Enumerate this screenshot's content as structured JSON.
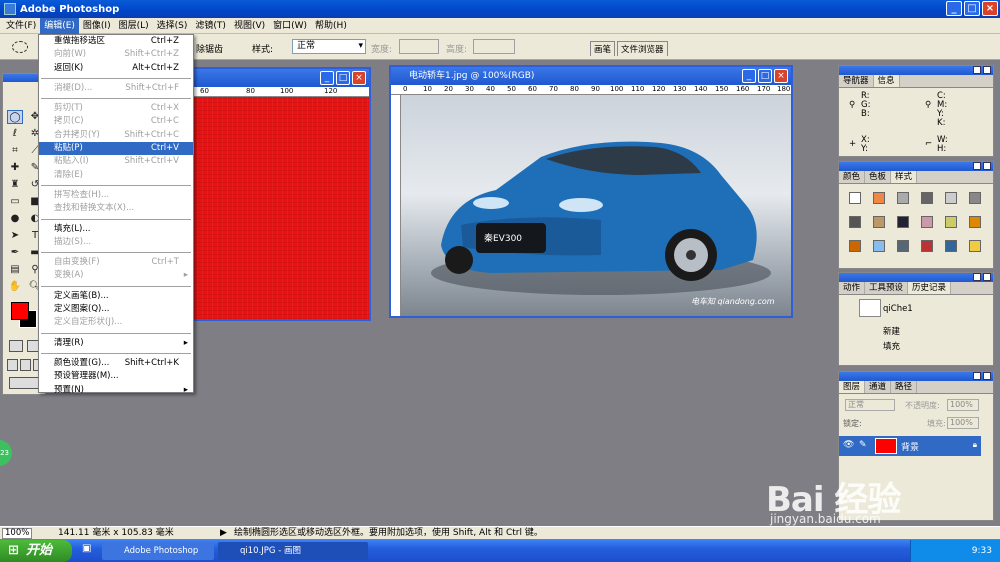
{
  "app": {
    "title": "Adobe Photoshop"
  },
  "menubar": [
    "文件(F)",
    "编辑(E)",
    "图像(I)",
    "图层(L)",
    "选择(S)",
    "滤镜(T)",
    "视图(V)",
    "窗口(W)",
    "帮助(H)"
  ],
  "options": {
    "partial": "除锯齿",
    "style_label": "样式:",
    "style_value": "正常",
    "width_label": "宽度:",
    "height_label": "高度:"
  },
  "tabs": [
    "画笔",
    "文件浏览器"
  ],
  "edit_menu": [
    {
      "label": "重做拖移选区",
      "shortcut": "Ctrl+Z",
      "state": "normal"
    },
    {
      "label": "向前(W)",
      "shortcut": "Shift+Ctrl+Z",
      "state": "disabled"
    },
    {
      "label": "返回(K)",
      "shortcut": "Alt+Ctrl+Z",
      "state": "normal"
    },
    {
      "sep": true
    },
    {
      "label": "消褪(D)...",
      "shortcut": "Shift+Ctrl+F",
      "state": "disabled"
    },
    {
      "sep": true
    },
    {
      "label": "剪切(T)",
      "shortcut": "Ctrl+X",
      "state": "disabled"
    },
    {
      "label": "拷贝(C)",
      "shortcut": "Ctrl+C",
      "state": "disabled"
    },
    {
      "label": "合并拷贝(Y)",
      "shortcut": "Shift+Ctrl+C",
      "state": "disabled"
    },
    {
      "label": "粘贴(P)",
      "shortcut": "Ctrl+V",
      "state": "highlighted"
    },
    {
      "label": "粘贴入(I)",
      "shortcut": "Shift+Ctrl+V",
      "state": "disabled"
    },
    {
      "label": "清除(E)",
      "shortcut": "",
      "state": "disabled"
    },
    {
      "sep": true
    },
    {
      "label": "拼写检查(H)...",
      "shortcut": "",
      "state": "disabled"
    },
    {
      "label": "查找和替换文本(X)...",
      "shortcut": "",
      "state": "disabled"
    },
    {
      "sep": true
    },
    {
      "label": "填充(L)...",
      "shortcut": "",
      "state": "normal"
    },
    {
      "label": "描边(S)...",
      "shortcut": "",
      "state": "disabled"
    },
    {
      "sep": true
    },
    {
      "label": "自由变换(F)",
      "shortcut": "Ctrl+T",
      "state": "disabled"
    },
    {
      "label": "变换(A)",
      "shortcut": "",
      "state": "disabled",
      "submenu": true
    },
    {
      "sep": true
    },
    {
      "label": "定义画笔(B)...",
      "shortcut": "",
      "state": "normal"
    },
    {
      "label": "定义图案(Q)...",
      "shortcut": "",
      "state": "normal"
    },
    {
      "label": "定义自定形状(J)...",
      "shortcut": "",
      "state": "disabled"
    },
    {
      "sep": true
    },
    {
      "label": "清理(R)",
      "shortcut": "",
      "state": "normal",
      "submenu": true
    },
    {
      "sep": true
    },
    {
      "label": "颜色设置(G)...",
      "shortcut": "Shift+Ctrl+K",
      "state": "normal"
    },
    {
      "label": "预设管理器(M)...",
      "shortcut": "",
      "state": "normal"
    },
    {
      "label": "预置(N)",
      "shortcut": "",
      "state": "normal",
      "submenu": true
    }
  ],
  "doc1": {
    "ruler": [
      "60",
      "80",
      "100",
      "120"
    ]
  },
  "doc2": {
    "title": "电动轿车1.jpg @ 100%(RGB)",
    "ruler": [
      "0",
      "10",
      "20",
      "30",
      "40",
      "50",
      "60",
      "70",
      "80",
      "90",
      "100",
      "110",
      "120",
      "130",
      "140",
      "150",
      "160",
      "170",
      "180"
    ],
    "plate": "秦EV300",
    "watermark": "电车知 qiandong.com"
  },
  "panel_nav": {
    "tabs": [
      "导航器",
      "信息"
    ],
    "rgb": [
      "R:",
      "G:",
      "B:"
    ],
    "cmyk": [
      "C:",
      "M:",
      "Y:",
      "K:"
    ],
    "xy": [
      "X:",
      "Y:"
    ],
    "wh": [
      "W:",
      "H:"
    ]
  },
  "panel_colors": {
    "tabs": [
      "颜色",
      "色板",
      "样式"
    ]
  },
  "panel_history": {
    "tabs": [
      "动作",
      "工具预设",
      "历史记录"
    ],
    "snapshot": "qiChe1",
    "steps": [
      "新建",
      "填充"
    ]
  },
  "panel_layers": {
    "tabs": [
      "图层",
      "通道",
      "路径"
    ],
    "mode": "正常",
    "opacity_label": "不透明度:",
    "opacity": "100%",
    "lock_label": "锁定:",
    "fill_label": "填充:",
    "fill": "100%",
    "layer_name": "背景"
  },
  "status": {
    "zoom": "100%",
    "size": "141.11 毫米 x 105.83 毫米",
    "hint": "绘制椭圆形选区或移动选区外框。要用附加选项，使用 Shift, Alt 和 Ctrl 键。"
  },
  "taskbar": {
    "start": "开始",
    "tasks": [
      "Adobe Photoshop",
      "qi10.JPG - 画图"
    ],
    "time": "9:33"
  },
  "badge": "23",
  "watermark": {
    "logo": "Bai 经验",
    "url": "jingyan.baidu.com"
  },
  "colors": {
    "accent": "#316ac5",
    "fg": "#ff0000",
    "bg": "#000000"
  }
}
